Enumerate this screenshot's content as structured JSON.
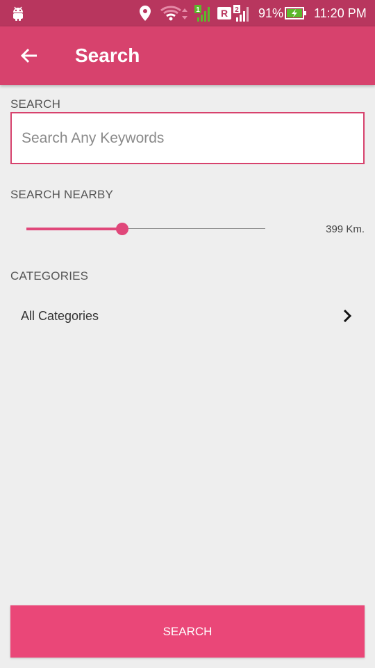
{
  "status_bar": {
    "battery_percent": "91%",
    "time": "11:20 PM",
    "icons": [
      "android-icon",
      "location-icon",
      "wifi-icon",
      "sim1-signal-icon",
      "roaming-icon",
      "sim2-signal-icon",
      "battery-charging-icon"
    ]
  },
  "app_bar": {
    "title": "Search",
    "back_icon": "arrow-left-icon"
  },
  "search": {
    "label": "SEARCH",
    "placeholder": "Search Any Keywords",
    "value": ""
  },
  "nearby": {
    "label": "SEARCH NEARBY",
    "distance_text": "399 Km.",
    "slider_fraction": 0.4
  },
  "categories": {
    "label": "CATEGORIES",
    "selected": "All Categories"
  },
  "actions": {
    "search_button": "SEARCH"
  },
  "colors": {
    "status_bar": "#b8365e",
    "app_bar": "#d7426d",
    "accent": "#ea4778",
    "background": "#eeeeee"
  }
}
